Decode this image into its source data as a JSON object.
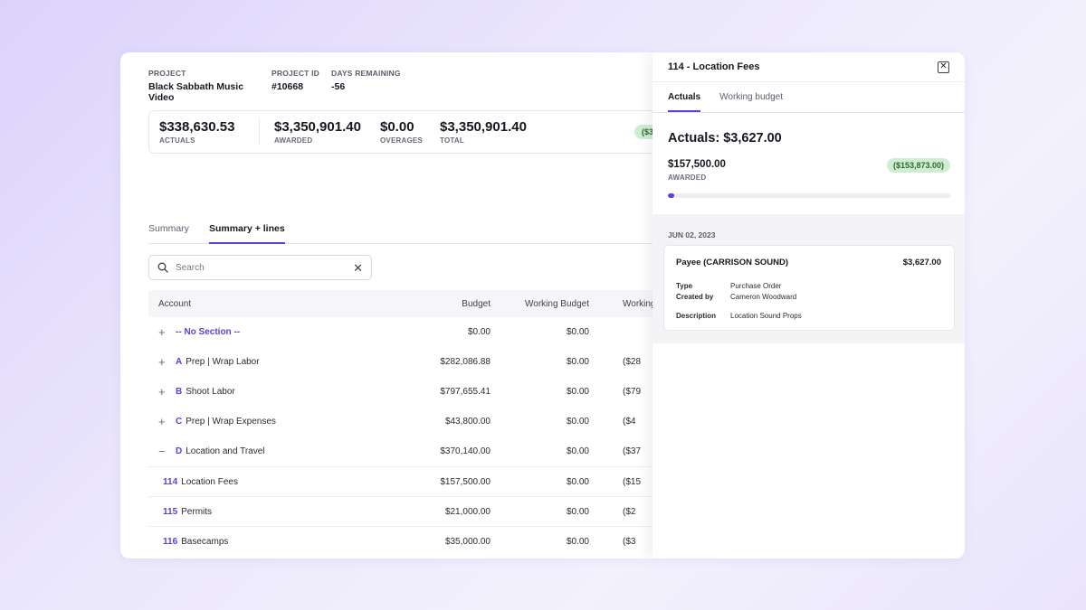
{
  "project": {
    "label": "PROJECT",
    "name": "Black Sabbath Music Video",
    "id_label": "PROJECT ID",
    "id": "#10668",
    "days_label": "DAYS REMAINING",
    "days": "-56"
  },
  "stats": {
    "actuals": {
      "value": "$338,630.53",
      "caption": "ACTUALS"
    },
    "awarded": {
      "value": "$3,350,901.40",
      "caption": "AWARDED"
    },
    "overages": {
      "value": "$0.00",
      "caption": "OVERAGES"
    },
    "total": {
      "value": "$3,350,901.40",
      "caption": "TOTAL"
    },
    "badge": "($3"
  },
  "tabs": [
    {
      "label": "Summary"
    },
    {
      "label": "Summary + lines"
    }
  ],
  "search": {
    "placeholder": "Search",
    "value": "",
    "clear": "✕"
  },
  "table": {
    "headers": {
      "account": "Account",
      "budget": "Budget",
      "working_budget": "Working Budget",
      "working": "Working"
    },
    "rows": [
      {
        "toggle": "+",
        "code": "",
        "name": "-- No Section --",
        "budget": "$0.00",
        "working_budget": "$0.00",
        "working": ""
      },
      {
        "toggle": "+",
        "code": "A",
        "name": "Prep | Wrap Labor",
        "budget": "$282,086.88",
        "working_budget": "$0.00",
        "working": "($28"
      },
      {
        "toggle": "+",
        "code": "B",
        "name": "Shoot Labor",
        "budget": "$797,655.41",
        "working_budget": "$0.00",
        "working": "($79"
      },
      {
        "toggle": "+",
        "code": "C",
        "name": "Prep | Wrap Expenses",
        "budget": "$43,800.00",
        "working_budget": "$0.00",
        "working": "($4"
      },
      {
        "toggle": "−",
        "code": "D",
        "name": "Location and Travel",
        "budget": "$370,140.00",
        "working_budget": "$0.00",
        "working": "($37"
      }
    ],
    "sub_rows": [
      {
        "code": "114",
        "name": "Location Fees",
        "budget": "$157,500.00",
        "working_budget": "$0.00",
        "working": "($15"
      },
      {
        "code": "115",
        "name": "Permits",
        "budget": "$21,000.00",
        "working_budget": "$0.00",
        "working": "($2"
      },
      {
        "code": "116",
        "name": "Basecamps",
        "budget": "$35,000.00",
        "working_budget": "$0.00",
        "working": "($3"
      }
    ]
  },
  "panel": {
    "title": "114 - Location Fees",
    "close": "✕",
    "tabs": [
      {
        "label": "Actuals"
      },
      {
        "label": "Working budget"
      }
    ],
    "actuals_heading": "Actuals: $3,627.00",
    "awarded_amount": "$157,500.00",
    "awarded_caption": "AWARDED",
    "variance_badge": "($153,873.00)",
    "progress_fraction": 0.023,
    "date": "JUN 02, 2023",
    "transaction": {
      "payee": "Payee (CARRISON SOUND)",
      "amount": "$3,627.00",
      "type_label": "Type",
      "type": "Purchase Order",
      "created_label": "Created by",
      "created_by": "Cameron Woodward",
      "desc_label": "Description",
      "description": "Location Sound Props"
    }
  },
  "colors": {
    "accent": "#5b3fd6",
    "badge_bg": "#cfeed0",
    "badge_text": "#2b6a33"
  }
}
